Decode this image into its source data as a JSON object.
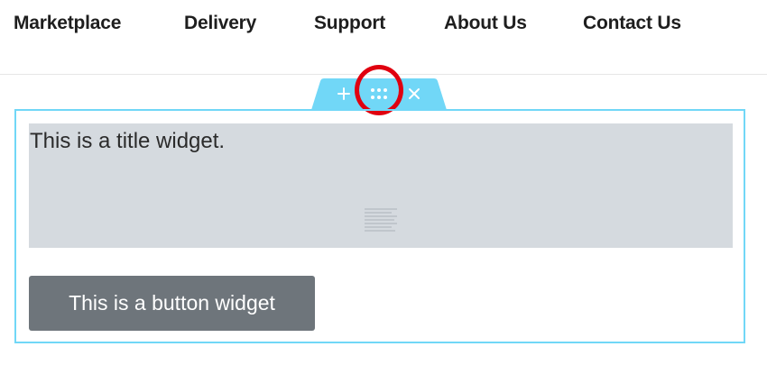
{
  "nav": {
    "items": [
      {
        "label": "Marketplace"
      },
      {
        "label": "Delivery"
      },
      {
        "label": "Support"
      },
      {
        "label": "About Us"
      },
      {
        "label": "Contact Us"
      }
    ]
  },
  "section_handle": {
    "icons": [
      "plus-icon",
      "drag-handle-icon",
      "close-icon"
    ],
    "color": "#71d7f7",
    "highlight_color": "#e0000f"
  },
  "widgets": {
    "title": "This is a title widget.",
    "button": "This is a button widget"
  },
  "colors": {
    "section_border": "#71d7f7",
    "title_widget_bg": "#d5dadf",
    "button_bg": "#6e757b"
  }
}
